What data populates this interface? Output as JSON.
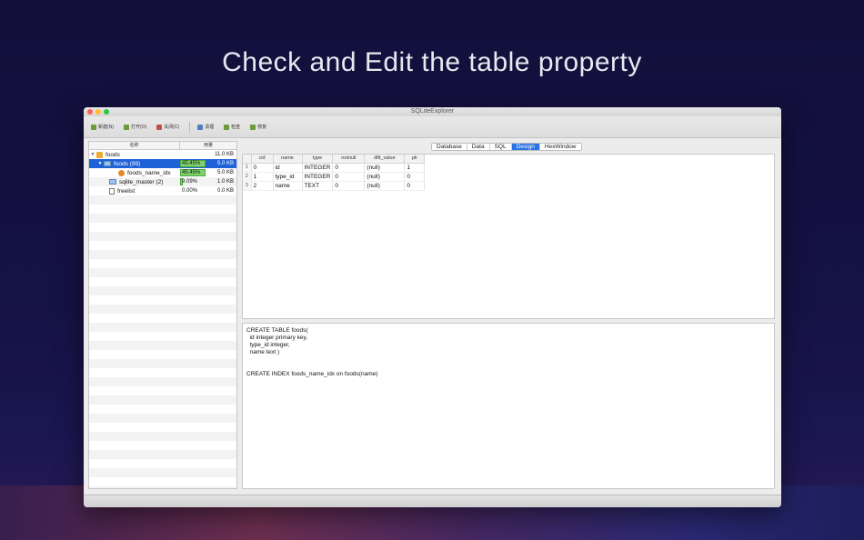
{
  "headline": "Check and Edit the table property",
  "window": {
    "title": "SQLiteExplorer"
  },
  "toolbar": {
    "buttons": [
      {
        "label": "新建(N)",
        "icon": "new-db-icon"
      },
      {
        "label": "打开(O)",
        "icon": "open-icon"
      },
      {
        "label": "关闭(C)",
        "icon": "close-db-icon"
      },
      {
        "label": "清理",
        "icon": "vacuum-icon"
      },
      {
        "label": "检查",
        "icon": "check-icon"
      },
      {
        "label": "修复",
        "icon": "repair-icon"
      }
    ]
  },
  "tree": {
    "header": {
      "name": "名称",
      "usage": "用量"
    },
    "rows": [
      {
        "name": "foods",
        "pct": "",
        "pct_value": 0,
        "size": "11.0 KB"
      },
      {
        "name": "foods (99)",
        "pct": "45.45%",
        "pct_value": 45.45,
        "size": "5.0 KB"
      },
      {
        "name": "foods_name_idx",
        "pct": "45.45%",
        "pct_value": 45.45,
        "size": "5.0 KB"
      },
      {
        "name": "sqlite_master (2)",
        "pct": "9.09%",
        "pct_value": 9.09,
        "size": "1.0 KB"
      },
      {
        "name": "freelist",
        "pct": "0.00%",
        "pct_value": 0,
        "size": "0.0 KB"
      }
    ]
  },
  "tabs": [
    "Database",
    "Data",
    "SQL",
    "Design",
    "HexWindow"
  ],
  "active_tab": "Design",
  "design_table": {
    "columns": [
      "cid",
      "name",
      "type",
      "notnull",
      "dflt_value",
      "pk"
    ],
    "rows": [
      {
        "rn": "1",
        "cells": [
          "0",
          "id",
          "INTEGER",
          "0",
          "(null)",
          "1"
        ]
      },
      {
        "rn": "2",
        "cells": [
          "1",
          "type_id",
          "INTEGER",
          "0",
          "(null)",
          "0"
        ]
      },
      {
        "rn": "3",
        "cells": [
          "2",
          "name",
          "TEXT",
          "0",
          "(null)",
          "0"
        ]
      }
    ]
  },
  "sql_lines": [
    "CREATE TABLE foods(",
    "  id integer primary key,",
    "  type_id integer,",
    "  name text )",
    "",
    "",
    "CREATE INDEX foods_name_idx on foods(name)"
  ],
  "colors": {
    "selection": "#1f62d8",
    "active_tab": "#2a73e6",
    "usage_bar": "#7fd36b"
  }
}
